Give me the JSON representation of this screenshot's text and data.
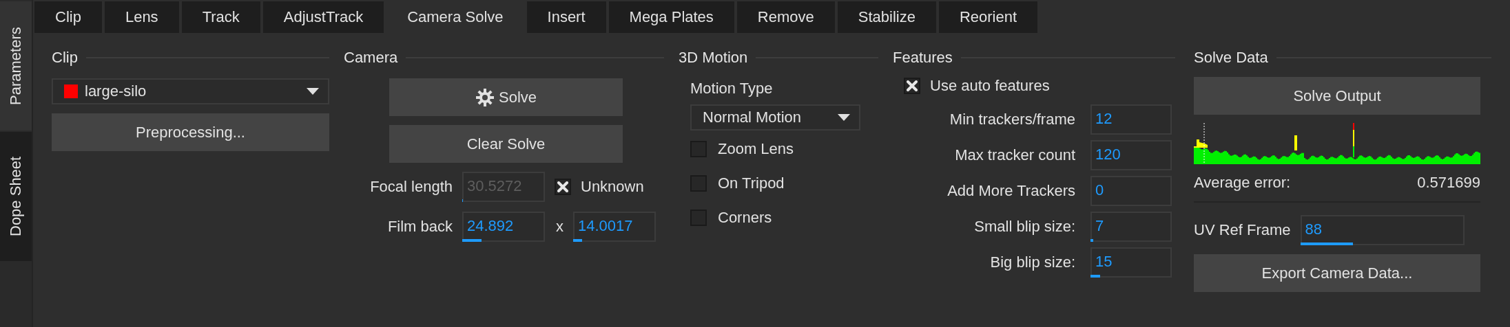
{
  "side_tabs": [
    {
      "label": "Parameters",
      "selected": true
    },
    {
      "label": "Dope Sheet",
      "selected": false
    }
  ],
  "tabs": [
    {
      "label": "Clip",
      "selected": false
    },
    {
      "label": "Lens",
      "selected": false
    },
    {
      "label": "Track",
      "selected": false
    },
    {
      "label": "AdjustTrack",
      "selected": false
    },
    {
      "label": "Camera Solve",
      "selected": true
    },
    {
      "label": "Insert",
      "selected": false
    },
    {
      "label": "Mega Plates",
      "selected": false
    },
    {
      "label": "Remove",
      "selected": false
    },
    {
      "label": "Stabilize",
      "selected": false
    },
    {
      "label": "Reorient",
      "selected": false
    }
  ],
  "clip": {
    "title": "Clip",
    "clip_select": {
      "value": "large-silo",
      "color": "#ff0000"
    },
    "preprocess_button": "Preprocessing..."
  },
  "camera": {
    "title": "Camera",
    "solve_button": "Solve",
    "clear_button": "Clear Solve",
    "focal_length": {
      "label": "Focal length",
      "value": "30.5272",
      "disabled": true,
      "level": 0.01
    },
    "unknown": {
      "label": "Unknown",
      "checked": true
    },
    "film_back": {
      "label": "Film back",
      "width": {
        "value": "24.892",
        "level": 0.23
      },
      "separator": "x",
      "height": {
        "value": "14.0017",
        "level": 0.11
      }
    }
  },
  "motion": {
    "title": "3D Motion",
    "motion_type_label": "Motion Type",
    "motion_type": "Normal Motion",
    "options": [
      {
        "label": "Zoom Lens",
        "checked": false
      },
      {
        "label": "On Tripod",
        "checked": false
      },
      {
        "label": "Corners",
        "checked": false
      }
    ]
  },
  "features": {
    "title": "Features",
    "use_auto": {
      "label": "Use auto features",
      "checked": true
    },
    "fields": [
      {
        "label": "Min trackers/frame",
        "value": "12"
      },
      {
        "label": "Max tracker count",
        "value": "120"
      },
      {
        "label": "Add More Trackers",
        "value": "0"
      },
      {
        "label": "Small blip size:",
        "value": "7",
        "level": 0.03
      },
      {
        "label": "Big blip size:",
        "value": "15",
        "level": 0.12
      }
    ]
  },
  "solve_data": {
    "title": "Solve Data",
    "output_button": "Solve Output",
    "average_error": {
      "label": "Average error:",
      "value": "0.571699"
    },
    "uv_ref_frame": {
      "label": "UV Ref Frame",
      "value": "88",
      "level": 0.32
    },
    "export_button": "Export Camera Data..."
  }
}
